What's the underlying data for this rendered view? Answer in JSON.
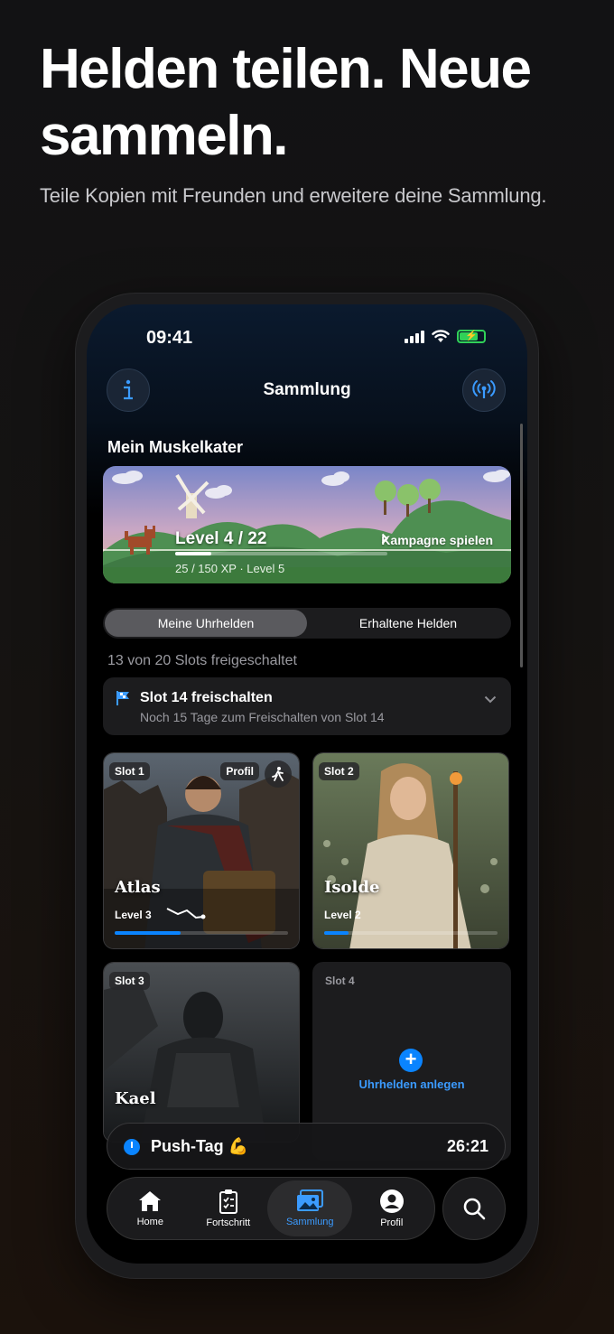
{
  "marketing": {
    "headline": "Helden teilen. Neue sammeln.",
    "subline": "Teile Kopien mit Freunden und erweitere deine Sammlung."
  },
  "status_bar": {
    "time": "09:41"
  },
  "nav": {
    "title": "Sammlung",
    "left_icon": "info-icon",
    "right_icon": "broadcast-icon"
  },
  "campaign": {
    "section_title": "Mein Muskelkater",
    "level_text": "Level 4 / 22",
    "progress": 0.17,
    "xp_text": "25 / 150 XP · Level 5",
    "cta": "Kampagne spielen"
  },
  "segments": [
    {
      "label": "Meine Uhrhelden",
      "active": true
    },
    {
      "label": "Erhaltene Helden",
      "active": false
    }
  ],
  "slots_info": "13 von 20 Slots freigeschaltet",
  "unlock": {
    "title": "Slot 14 freischalten",
    "subtitle": "Noch 15 Tage zum Freischalten von Slot 14"
  },
  "heroes": [
    {
      "slot": "Slot 1",
      "name": "Atlas",
      "level": "Level 3",
      "progress": 0.38,
      "badge": "Profil"
    },
    {
      "slot": "Slot 2",
      "name": "Isolde",
      "level": "Level 2",
      "progress": 0.14
    },
    {
      "slot": "Slot 3",
      "name": "Kael"
    }
  ],
  "empty_slot": {
    "label": "Slot 4",
    "cta": "Uhrhelden anlegen"
  },
  "push": {
    "label": "Push-Tag 💪",
    "time": "26:21"
  },
  "tabs": [
    {
      "label": "Home",
      "icon": "home-icon"
    },
    {
      "label": "Fortschritt",
      "icon": "clipboard-icon"
    },
    {
      "label": "Sammlung",
      "icon": "photos-icon",
      "active": true
    },
    {
      "label": "Profil",
      "icon": "profile-icon"
    }
  ],
  "colors": {
    "accent": "#0a84ff",
    "battery": "#30d158"
  }
}
